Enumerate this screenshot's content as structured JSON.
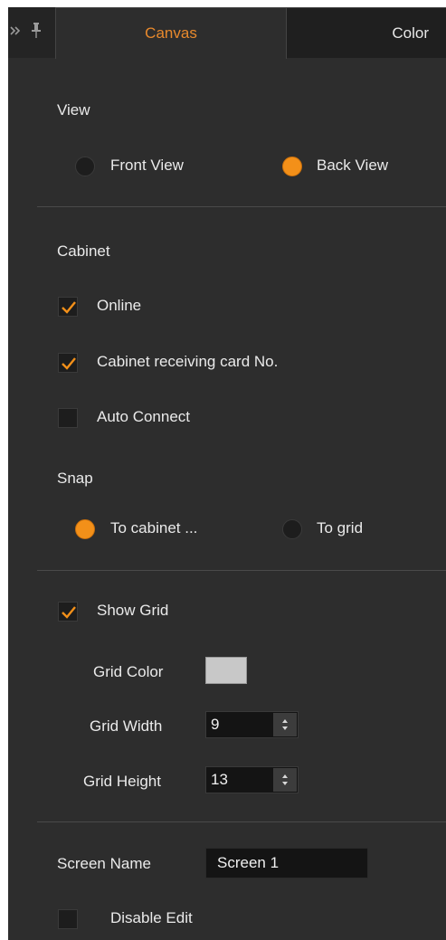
{
  "tabs": [
    {
      "label": "Canvas",
      "active": true
    },
    {
      "label": "Color",
      "active": false
    }
  ],
  "view": {
    "heading": "View",
    "options": [
      {
        "label": "Front View",
        "selected": false
      },
      {
        "label": "Back View",
        "selected": true
      }
    ]
  },
  "cabinet": {
    "heading": "Cabinet",
    "checks": [
      {
        "label": "Online",
        "checked": true
      },
      {
        "label": "Cabinet receiving card No.",
        "checked": true
      },
      {
        "label": "Auto Connect",
        "checked": false
      }
    ]
  },
  "snap": {
    "heading": "Snap",
    "options": [
      {
        "label": "To cabinet ...",
        "selected": true
      },
      {
        "label": "To grid",
        "selected": false
      }
    ]
  },
  "grid": {
    "show_label": "Show Grid",
    "show_checked": true,
    "color_label": "Grid Color",
    "color_value": "#c8c8c8",
    "width_label": "Grid Width",
    "width_value": "9",
    "height_label": "Grid Height",
    "height_value": "13"
  },
  "screen": {
    "name_label": "Screen Name",
    "name_value": "Screen 1",
    "disable_label": "Disable Edit",
    "disable_checked": false
  },
  "colors": {
    "accent": "#f39019",
    "panel": "#2d2d2d",
    "text": "#eaeaea"
  }
}
